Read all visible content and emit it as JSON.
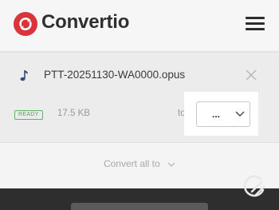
{
  "header": {
    "brand": "Convertio",
    "logo_icon": "convertio-logo-icon",
    "menu_icon": "hamburger-menu-icon"
  },
  "file": {
    "icon": "music-note-icon",
    "name": "PTT-20251130-WA0000.opus",
    "status": "READY",
    "size": "17.5 KB",
    "to_label": "to",
    "format_value": "...",
    "remove_icon": "close-icon"
  },
  "actions": {
    "convert_all_label": "Convert all to"
  },
  "colors": {
    "brand_red": "#d8353b",
    "ready_green": "#4fa554",
    "footer_dark": "#2e2e2e"
  }
}
